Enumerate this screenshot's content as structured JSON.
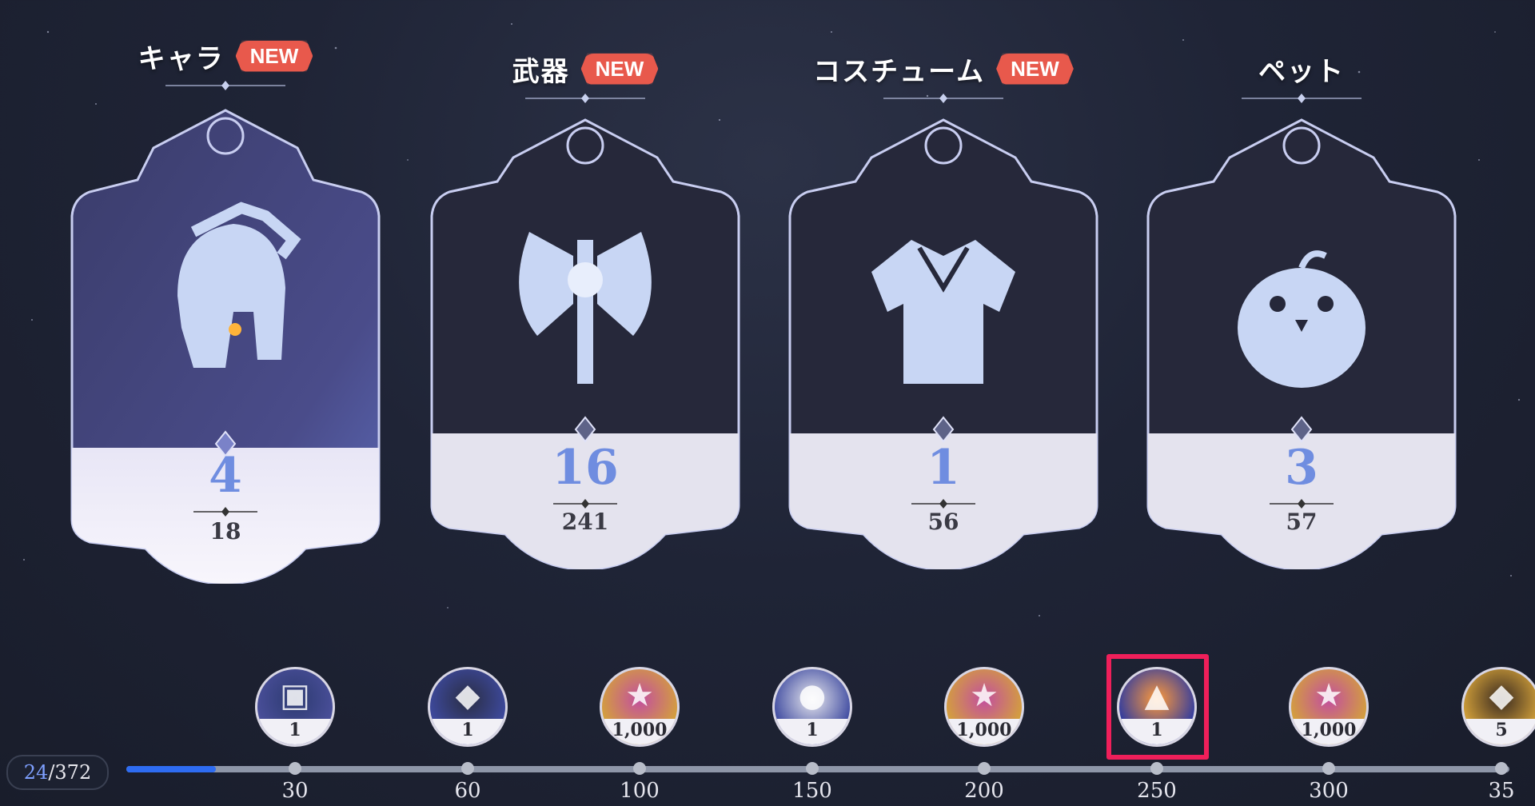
{
  "categories": [
    {
      "title": "キャラ",
      "badge": "NEW",
      "count": "4",
      "total": "18",
      "icon": "helmet-icon"
    },
    {
      "title": "武器",
      "badge": "NEW",
      "count": "16",
      "total": "241",
      "icon": "axe-icon"
    },
    {
      "title": "コスチューム",
      "badge": "NEW",
      "count": "1",
      "total": "56",
      "icon": "shirt-icon"
    },
    {
      "title": "ペット",
      "badge": "",
      "count": "3",
      "total": "57",
      "icon": "chick-icon"
    }
  ],
  "progress": {
    "current": "24",
    "total": "/372",
    "fraction": 0.065
  },
  "rewards": [
    {
      "milestone": "30",
      "qty": "1",
      "icon": "treasure-chest-icon"
    },
    {
      "milestone": "60",
      "qty": "1",
      "icon": "wolf-pet-icon"
    },
    {
      "milestone": "100",
      "qty": "1,000",
      "icon": "star-crystal-icon"
    },
    {
      "milestone": "150",
      "qty": "1",
      "icon": "goat-pet-icon"
    },
    {
      "milestone": "200",
      "qty": "1,000",
      "icon": "star-crystal-icon"
    },
    {
      "milestone": "250",
      "qty": "1",
      "icon": "fire-bird-pet-icon"
    },
    {
      "milestone": "300",
      "qty": "1,000",
      "icon": "star-crystal-icon"
    },
    {
      "milestone": "35",
      "qty": "5",
      "icon": "creature-icon"
    }
  ],
  "colors": {
    "accent": "#6f8de0",
    "badge": "#e8594c",
    "track_fill": "#2e6cf2",
    "highlight": "#ef1f5a"
  }
}
